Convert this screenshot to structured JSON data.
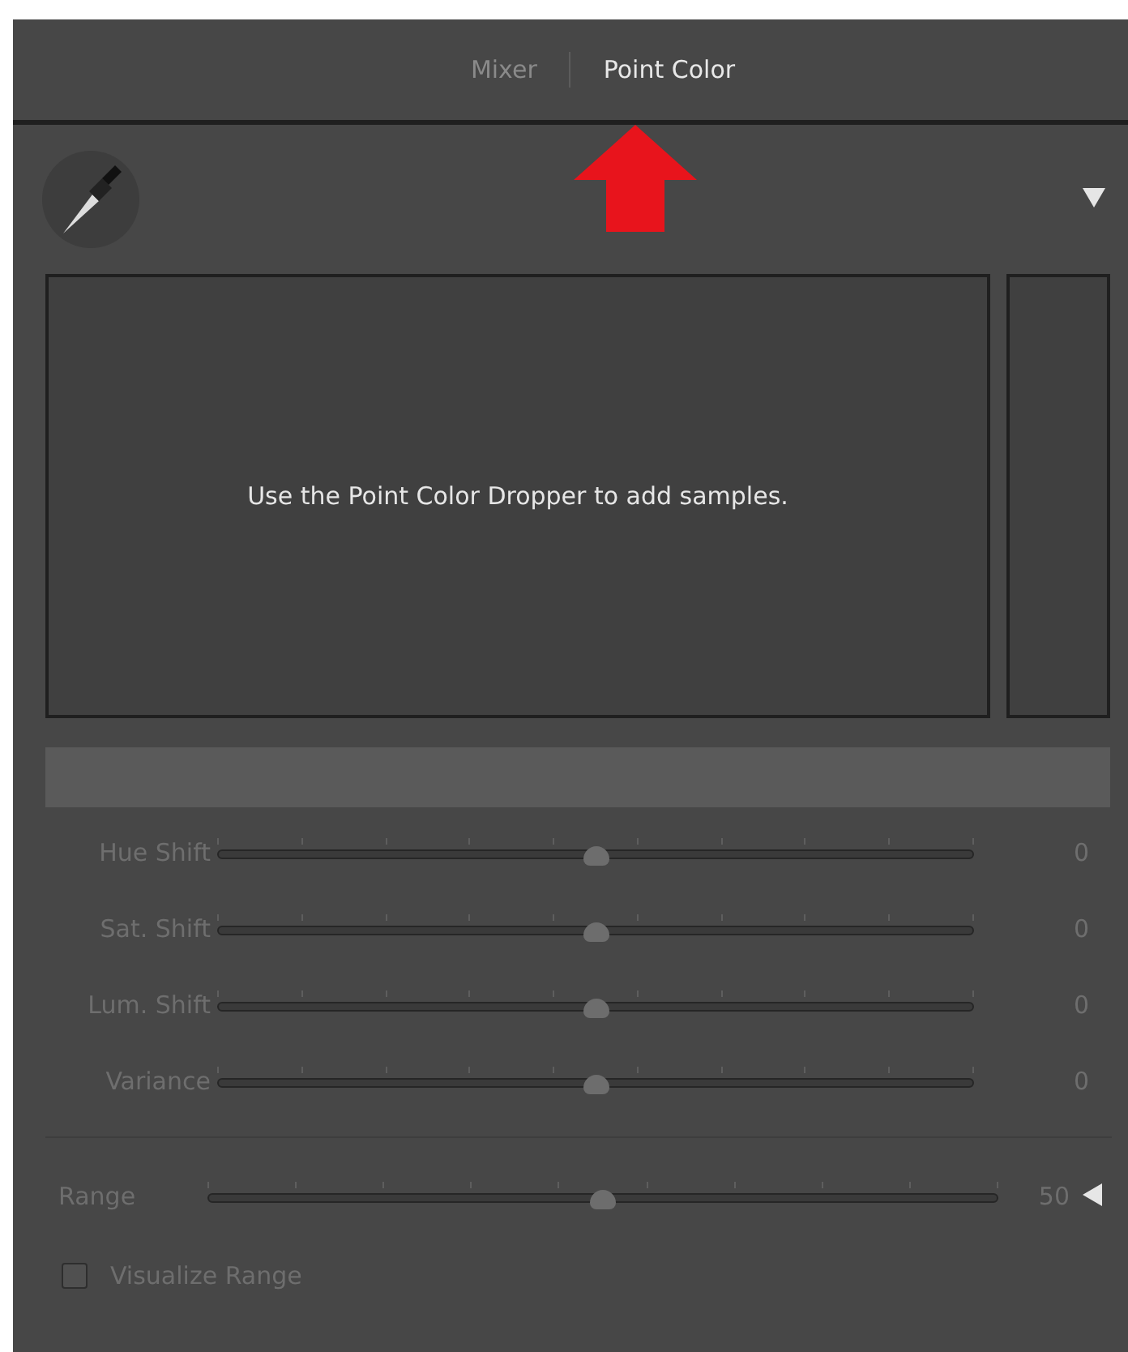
{
  "tabs": [
    {
      "label": "Mixer",
      "selected": false
    },
    {
      "label": "Point Color",
      "selected": true
    }
  ],
  "sample_area": {
    "message": "Use the Point Color Dropper to add samples."
  },
  "adjustments": [
    {
      "label": "Hue Shift",
      "level": 0.5,
      "reading": "0",
      "disabled": true
    },
    {
      "label": "Sat. Shift",
      "level": 0.5,
      "reading": "0",
      "disabled": true
    },
    {
      "label": "Lum. Shift",
      "level": 0.5,
      "reading": "0",
      "disabled": true
    },
    {
      "label": "Variance",
      "level": 0.5,
      "reading": "0",
      "disabled": true
    }
  ],
  "range": {
    "label": "Range",
    "level": 0.5,
    "reading": "50",
    "disabled": true
  },
  "visualize_range": {
    "label": "Visualize Range",
    "checked": false,
    "disabled": true
  }
}
